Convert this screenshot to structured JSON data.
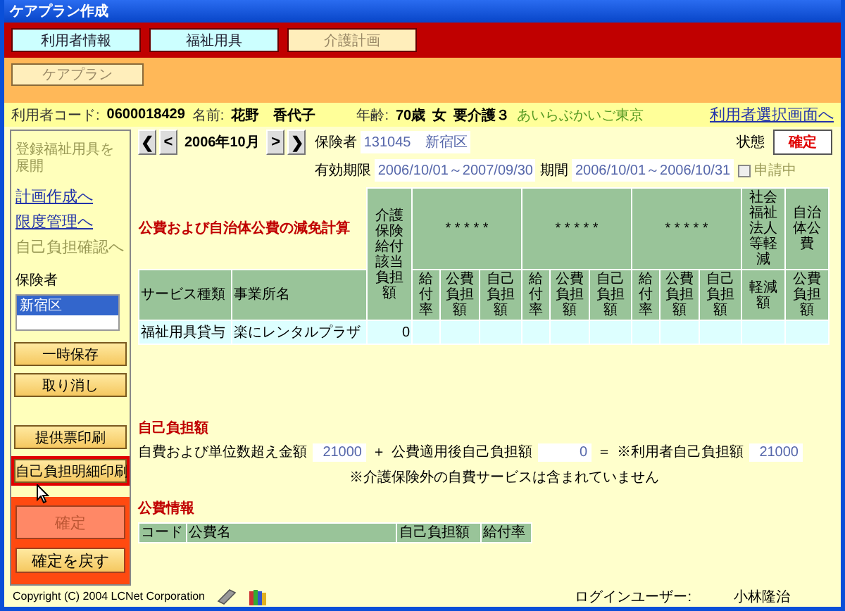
{
  "window": {
    "title": "ケアプラン作成"
  },
  "tabs": [
    {
      "label": "利用者情報",
      "selected": false
    },
    {
      "label": "福祉用具",
      "selected": false
    },
    {
      "label": "介護計画",
      "selected": true
    }
  ],
  "subtabs": [
    {
      "label": "ケアプラン",
      "selected": true
    }
  ],
  "user": {
    "code_label": "利用者コード:",
    "code": "0600018429",
    "name_label": "名前:",
    "name": "花野　香代子",
    "age_label": "年齢:",
    "age": "70歳",
    "gender": "女",
    "care_level": "要介護３",
    "office": "あいらぶかいご東京",
    "link": "利用者選択画面へ"
  },
  "sidebar": {
    "items": [
      {
        "label": "登録福祉用具を展開",
        "kind": "toggle"
      },
      {
        "label": "計画作成へ",
        "kind": "link"
      },
      {
        "label": "限度管理へ",
        "kind": "link"
      },
      {
        "label": "自己負担確認へ",
        "kind": "current"
      }
    ],
    "insurer_label": "保険者",
    "insurers": [
      {
        "label": "新宿区",
        "selected": true
      }
    ],
    "buttons": [
      {
        "label": "一時保存",
        "focused": false
      },
      {
        "label": "取り消し",
        "focused": false
      },
      {
        "label": "提供票印刷",
        "focused": false
      },
      {
        "label": "自己負担明細印刷",
        "focused": true
      }
    ],
    "confirm_buttons": [
      {
        "label": "確定",
        "disabled": true
      },
      {
        "label": "確定を戻す",
        "disabled": false
      }
    ]
  },
  "nav": {
    "prev_buttons": [
      "❮",
      "<"
    ],
    "month": "2006年10月",
    "next_buttons": [
      ">",
      "❯"
    ]
  },
  "insurer": {
    "label": "保険者",
    "code": "131045",
    "name": "新宿区"
  },
  "validity": {
    "label": "有効期限",
    "value": "2006/10/01～2007/09/30"
  },
  "period": {
    "label": "期間",
    "value": "2006/10/01～2006/10/31"
  },
  "application": {
    "label": "申請中",
    "checked": false
  },
  "status": {
    "label": "状態",
    "value": "確定"
  },
  "reduction": {
    "title": "公費および自治体公費の減免計算",
    "columns": [
      {
        "label": "サービス種類"
      },
      {
        "label": "事業所名"
      },
      {
        "label": "介護保険給付該当負担額"
      },
      {
        "label": "* * * * *",
        "children": [
          "給付率",
          "公費負担額",
          "自己負担額"
        ]
      },
      {
        "label": "* * * * *",
        "children": [
          "給付率",
          "公費負担額",
          "自己負担額"
        ]
      },
      {
        "label": "* * * * *",
        "children": [
          "給付率",
          "公費負担額",
          "自己負担額"
        ]
      },
      {
        "label": "社会福祉法人等軽減",
        "children": [
          "軽減額"
        ]
      },
      {
        "label": "自治体公費",
        "children": [
          "公費負担額"
        ]
      }
    ],
    "rows": [
      {
        "cells": [
          "福祉用具貸与",
          "楽にレンタルプラザ",
          "0"
        ]
      }
    ]
  },
  "self_pay": {
    "title": "自己負担額",
    "items": [
      {
        "label": "自費および単位数超え金額",
        "value": "21000"
      },
      {
        "label": "公費適用後自己負担額",
        "value": "0"
      },
      {
        "label": "※利用者自己負担額",
        "value": "21000"
      }
    ],
    "operators": [
      "＋",
      "＝"
    ],
    "note": "※介護保険外の自費サービスは含まれていません"
  },
  "public_info": {
    "title": "公費情報",
    "columns": [
      "コード",
      "公費名",
      "自己負担額",
      "給付率"
    ]
  },
  "footer": {
    "copyright": "Copyright (C) 2004 LCNet Corporation",
    "user_label": "ログインユーザー:",
    "user": "小林隆治"
  }
}
